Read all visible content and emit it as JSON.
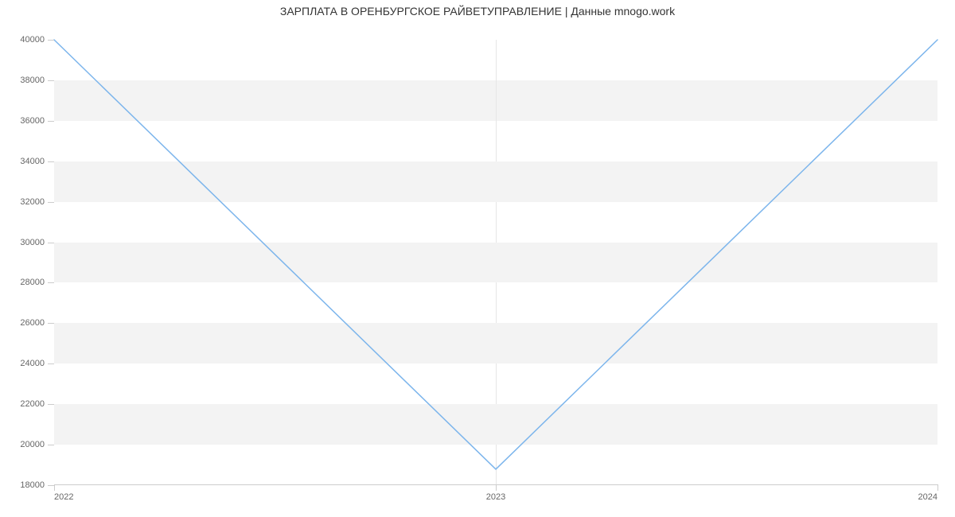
{
  "chart_data": {
    "type": "line",
    "title": "ЗАРПЛАТА В ОРЕНБУРГСКОЕ РАЙВЕТУПРАВЛЕНИЕ | Данные mnogo.work",
    "xlabel": "",
    "ylabel": "",
    "categories": [
      "2022",
      "2023",
      "2024"
    ],
    "values": [
      40000,
      18750,
      40000
    ],
    "ylim": [
      18000,
      40000
    ],
    "y_ticks": [
      18000,
      20000,
      22000,
      24000,
      26000,
      28000,
      30000,
      32000,
      34000,
      36000,
      38000,
      40000
    ],
    "grid": true,
    "legend": false,
    "series_color": "#7cb5ec"
  }
}
